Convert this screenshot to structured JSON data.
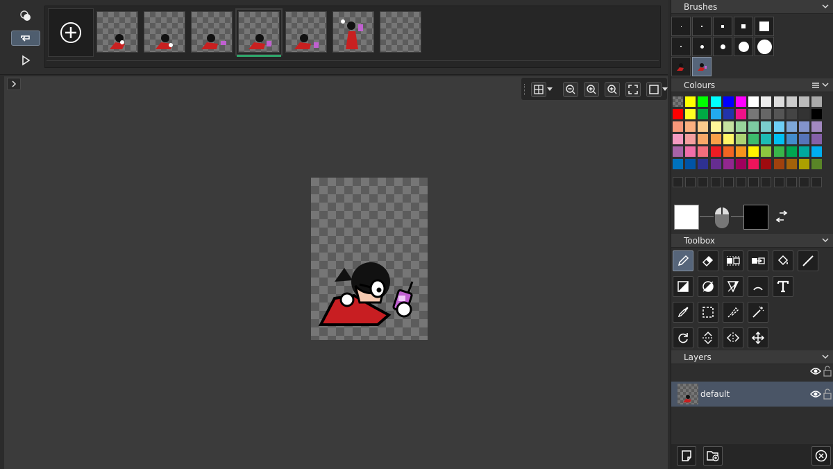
{
  "timeline": {
    "frame_count": 7,
    "selected_frame": 4,
    "add_frame_label": "add-frame"
  },
  "brushes": {
    "title": "Brushes"
  },
  "colours": {
    "title": "Colours",
    "primary": "#ffffff",
    "secondary": "#000000",
    "palette_rows": [
      [
        "checker",
        "#ffff00",
        "#00ff00",
        "#00ffff",
        "#0000ff",
        "#ff00ff",
        "#ffffff",
        "#eeeeee",
        "#dddddd",
        "#cccccc",
        "#bbbbbb",
        "#aaaaaa"
      ],
      [
        "#ff0000",
        "#ffff22",
        "#00aa44",
        "#22aaee",
        "#2233aa",
        "#ee1188",
        "#777777",
        "#666666",
        "#555555",
        "#444444",
        "#333333",
        "#000000"
      ],
      [
        "#f7987a",
        "#fbb080",
        "#fdcb8c",
        "#fff799",
        "#c5e19f",
        "#99d49b",
        "#7dcba2",
        "#7acccc",
        "#6ecff6",
        "#7da7d8",
        "#8393ca",
        "#a389c0"
      ],
      [
        "#f49ac1",
        "#f49fa0",
        "#f9a868",
        "#f9a048",
        "#fff467",
        "#acd373",
        "#3dbb6d",
        "#1cbbb4",
        "#00bff3",
        "#438ccb",
        "#5674b9",
        "#8560a8"
      ],
      [
        "#a763a8",
        "#f06ea9",
        "#f26d7d",
        "#ed1c24",
        "#f26522",
        "#f7941d",
        "#fff200",
        "#8dc63f",
        "#39b54a",
        "#00a651",
        "#00a99d",
        "#00aeef"
      ],
      [
        "#0072bc",
        "#0054a6",
        "#2e3192",
        "#662d91",
        "#92278f",
        "#9e005d",
        "#ed145b",
        "#9e0b0f",
        "#a0410d",
        "#a36209",
        "#aba000",
        "#598527"
      ]
    ]
  },
  "toolbox": {
    "title": "Toolbox"
  },
  "layers": {
    "title": "Layers",
    "items": [
      {
        "name": "default"
      }
    ]
  }
}
